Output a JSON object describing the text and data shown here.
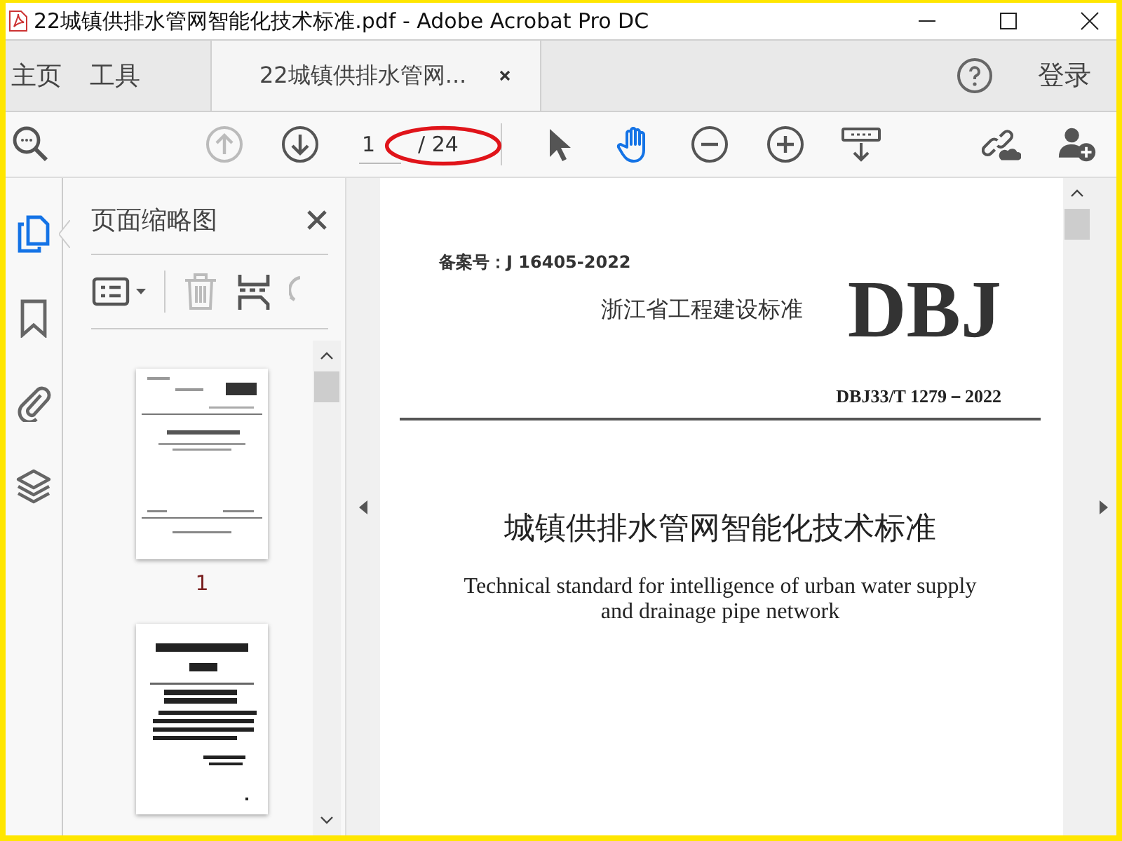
{
  "window": {
    "title": "22城镇供排水管网智能化技术标准.pdf - Adobe Acrobat Pro DC"
  },
  "nav_tabs": [
    {
      "label": "主页",
      "selected": false
    },
    {
      "label": "工具",
      "selected": false
    },
    {
      "label": "22城镇供排水管网...",
      "selected": true
    }
  ],
  "sign_in": "登录",
  "toolbar": {
    "page_input": "1",
    "page_total": "/ 24",
    "hand_tool_selected": true
  },
  "sidebar_icons": [
    {
      "kind": "pages",
      "selected": true
    },
    {
      "kind": "bookmark",
      "selected": false
    },
    {
      "kind": "attachment",
      "selected": false
    },
    {
      "kind": "layers",
      "selected": false
    }
  ],
  "thumbnails_panel": {
    "title": "页面缩略图",
    "pages": [
      {
        "kind": "cover",
        "label": "1"
      },
      {
        "kind": "notice"
      }
    ]
  },
  "document": {
    "filing_no": "备案号：J 16405-2022",
    "category": "浙江省工程建设标准",
    "mark": "DBJ",
    "code": "DBJ33/T 1279－2022",
    "title": "城镇供排水管网智能化技术标准",
    "subtitle": "Technical standard for intelligence of urban water supply and drainage pipe network"
  }
}
